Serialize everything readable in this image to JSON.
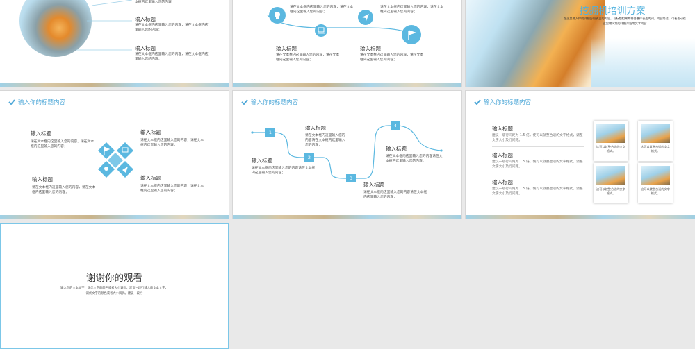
{
  "colors": {
    "accent": "#5bb8e0",
    "title_blue": "#4fa8d8",
    "text": "#555555"
  },
  "slide1": {
    "items": [
      {
        "title": "",
        "text": "本框内这里输入您的内容"
      },
      {
        "title": "输入标题",
        "text": "请在文本框内这里输入您的内容，请在文本框内这里输入您的内容；"
      },
      {
        "title": "输入标题",
        "text": "请在文本框内这里输入您的内容，请在文本框内这里输入您的内容；"
      }
    ]
  },
  "slide2": {
    "top_texts": [
      {
        "title": "",
        "text": "请在文本框内这里输入您的内容，请在文本框内这里输入您的内容；"
      },
      {
        "title": "",
        "text": "请在文本框内这里输入您的内容，请在文本框内这里输入您的内容；"
      }
    ],
    "bottom": [
      {
        "title": "输入标题",
        "text": "请在文本框内这里输入您的内容，请在文本框内这里输入您的内容；"
      },
      {
        "title": "输入标题",
        "text": "请在文本框内这里输入您的内容，请在文本框内这里输入您的内容；"
      }
    ],
    "icons": [
      "lightbulb-icon",
      "send-icon",
      "laptop-icon",
      "flag-icon"
    ]
  },
  "slide3": {
    "title": "挖掘机培训方案",
    "subtitle": "在这里输入你的详细分段表立的内容，与标题相来并符合整体表达的词，内容简洁、可着去动在这里输入您的详细介绍等文本内容"
  },
  "slide4": {
    "header": "输入你的标题内容",
    "items": [
      {
        "title": "输入标题",
        "text": "请在文本框内这里输入您的内容，请在文本框内这里输入您的内容；"
      },
      {
        "title": "输入标题",
        "text": "请在文本框内这里输入您的内容，请在文本框内这里输入您的内容；"
      },
      {
        "title": "输入标题",
        "text": "请在文本框内这里输入您的内容，请在文本框内这里输入您的内容；"
      },
      {
        "title": "输入标题",
        "text": "请在文本框内这里输入您的内容，请在文本框内这里输入您的内容；"
      }
    ]
  },
  "slide5": {
    "header": "输入你的标题内容",
    "nodes": [
      "1",
      "2",
      "3",
      "4"
    ],
    "items": [
      {
        "title": "输入标题",
        "text": "请在文本框内这里输入您的内容请在文本框内这里输入您的内容；"
      },
      {
        "title": "输入标题",
        "text": "请在文本框内这里输入您的内容请在文本框内这里输入您的内容；"
      },
      {
        "title": "输入标题",
        "text": "请在文本框内这里输入您的内容请在文本框内这里输入您的内容；"
      },
      {
        "title": "输入标题",
        "text": "请在文本框内这里输入您的内容请在文本框内这里输入您的内容；"
      }
    ]
  },
  "slide6": {
    "header": "输入你的标题内容",
    "items": [
      {
        "title": "输入标题",
        "text": "建议一级行间距为 1.5 倍，使可以就整合适的文字格式，调整文字大小及行间距。"
      },
      {
        "title": "输入标题",
        "text": "建议一级行间距为 1.5 倍，使可以就整合适的文字格式，调整文字大小及行间距。"
      },
      {
        "title": "输入标题",
        "text": "建议一级行间距为 1.5 倍，使可以就整合适的文字格式，调整文字大小及行间距。"
      }
    ],
    "cards": [
      "这可以就整合适的文字格式。",
      "这可以就整合适的文字格式。",
      "这可以就整合适的文字格式。",
      "这可以就整合适的文字格式。"
    ]
  },
  "slide7": {
    "title": "谢谢你的观看",
    "line1": "输入您的文本文字，调优文字的颜色或者大小调优。建议一段行输入的文本文字，",
    "line2": "调优文字的颜色或者大小调优。建议一段行"
  }
}
